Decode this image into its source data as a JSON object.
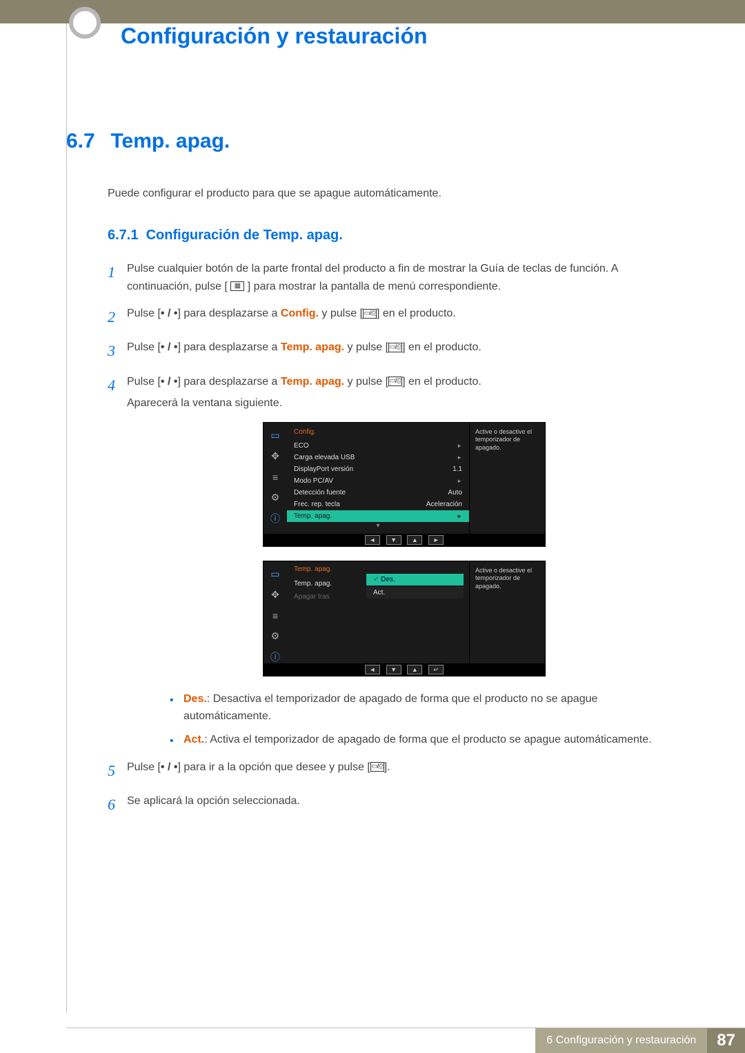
{
  "header": {
    "chapter_title": "Configuración y restauración"
  },
  "section": {
    "number": "6.7",
    "title": "Temp. apag.",
    "intro": "Puede configurar el producto para que se apague automáticamente."
  },
  "subsection": {
    "number": "6.7.1",
    "title": "Configuración de Temp. apag."
  },
  "steps": {
    "s1": {
      "num": "1",
      "a": "Pulse cualquier botón de la parte frontal del producto a fin de mostrar la Guía de teclas de función. A continuación, pulse [",
      "b": "] para mostrar la pantalla de menú correspondiente."
    },
    "s2": {
      "num": "2",
      "a": "Pulse [",
      "b": "] para desplazarse a ",
      "hl": "Config.",
      "c": " y pulse [",
      "d": "] en el producto."
    },
    "s3": {
      "num": "3",
      "a": "Pulse [",
      "b": "] para desplazarse a ",
      "hl": "Temp. apag.",
      "c": " y pulse [",
      "d": "] en el producto."
    },
    "s4": {
      "num": "4",
      "a": "Pulse [",
      "b": "] para desplazarse a ",
      "hl": "Temp. apag.",
      "c": " y pulse [",
      "d": "] en el producto.",
      "e": "Aparecerá la ventana siguiente."
    },
    "s5": {
      "num": "5",
      "a": "Pulse [",
      "b": "] para ir a la opción que desee y pulse [",
      "c": "]."
    },
    "s6": {
      "num": "6",
      "a": "Se aplicará la opción seleccionada."
    }
  },
  "osd1": {
    "header": "Config.",
    "rows": [
      {
        "label": "ECO",
        "value": "",
        "arrow": true
      },
      {
        "label": "Carga elevada USB",
        "value": "",
        "arrow": true
      },
      {
        "label": "DisplayPort versión",
        "value": "1.1",
        "arrow": false
      },
      {
        "label": "Modo PC/AV",
        "value": "",
        "arrow": true
      },
      {
        "label": "Detección fuente",
        "value": "Auto",
        "arrow": false
      },
      {
        "label": "Frec. rep. tecla",
        "value": "Aceleración",
        "arrow": false
      },
      {
        "label": "Temp. apag.",
        "value": "",
        "arrow": true,
        "selected": true
      }
    ],
    "desc": "Active o desactive el temporizador de apagado.",
    "nav": [
      "◄",
      "▼",
      "▲",
      "►"
    ]
  },
  "osd2": {
    "header": "Temp. apag.",
    "left": [
      {
        "label": "Temp. apag.",
        "dim": false
      },
      {
        "label": "Apagar tras",
        "dim": true
      }
    ],
    "options": [
      {
        "label": "Des.",
        "selected": true
      },
      {
        "label": "Act.",
        "selected": false
      }
    ],
    "desc": "Active o desactive el temporizador de apagado.",
    "nav": [
      "◄",
      "▼",
      "▲",
      "↵"
    ]
  },
  "bullets": {
    "b1": {
      "hl": "Des.",
      "text": ": Desactiva el temporizador de apagado de forma que el producto no se apague automáticamente."
    },
    "b2": {
      "hl": "Act.",
      "text": ": Activa el temporizador de apagado de forma que el producto se apague automáticamente."
    }
  },
  "footer": {
    "label": "6 Configuración y restauración",
    "page": "87"
  }
}
